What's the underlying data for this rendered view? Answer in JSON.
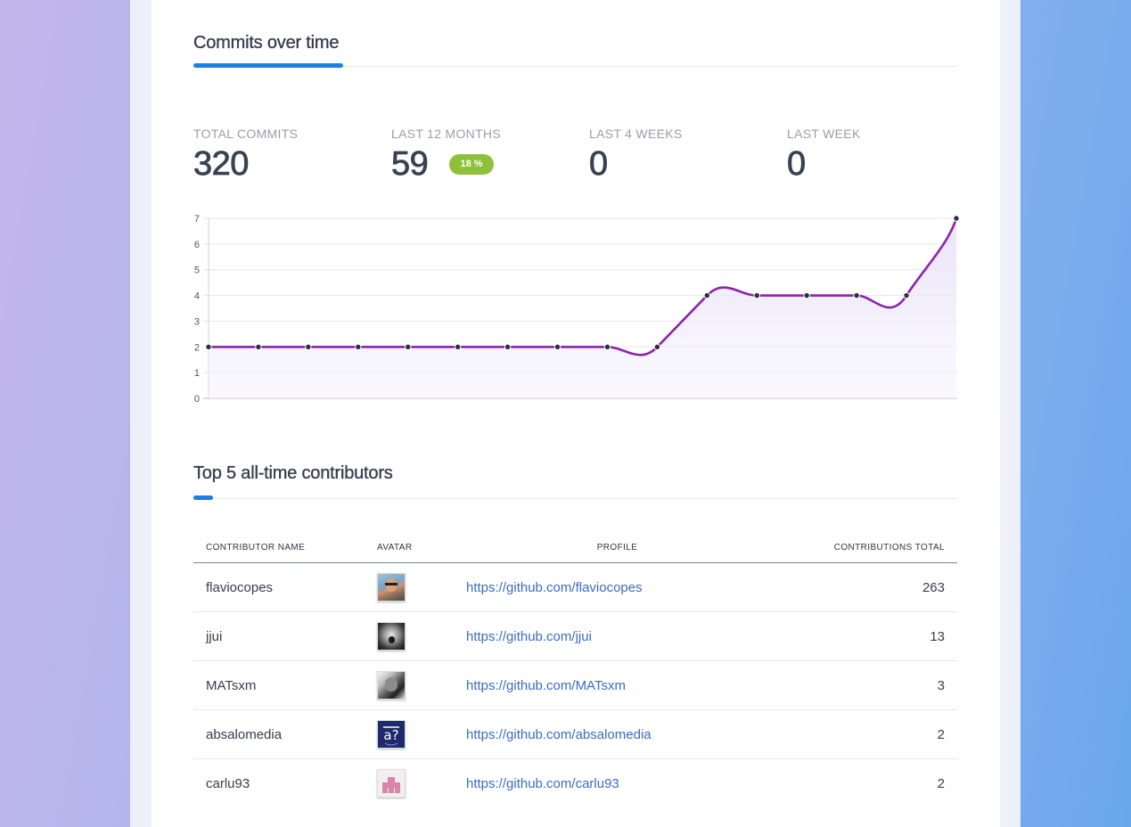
{
  "commits_section": {
    "title": "Commits over time",
    "stats": [
      {
        "label": "TOTAL COMMITS",
        "value": "320"
      },
      {
        "label": "LAST 12 MONTHS",
        "value": "59",
        "badge": "18 %"
      },
      {
        "label": "LAST 4 WEEKS",
        "value": "0"
      },
      {
        "label": "LAST WEEK",
        "value": "0"
      }
    ]
  },
  "chart_data": {
    "type": "area",
    "x": [
      1,
      2,
      3,
      4,
      5,
      6,
      7,
      8,
      9,
      10,
      11,
      12,
      13,
      14,
      15,
      16
    ],
    "series": [
      {
        "values": [
          2,
          2,
          2,
          2,
          2,
          2,
          2,
          2,
          2,
          2,
          4,
          4,
          4,
          4,
          4,
          7
        ]
      }
    ],
    "y_ticks": [
      "0",
      "1",
      "2",
      "3",
      "4",
      "5",
      "6",
      "7"
    ],
    "ylim": [
      0,
      7
    ],
    "grid": true,
    "colors": {
      "line": "#8e24aa",
      "fill": "#ede8fa",
      "point": "#2b2f3a",
      "grid": "#e5e6ea"
    }
  },
  "contributors_section": {
    "title": "Top 5 all-time contributors",
    "columns": {
      "name": "CONTRIBUTOR NAME",
      "avatar": "AVATAR",
      "profile": "PROFILE",
      "total": "CONTRIBUTIONS TOTAL"
    },
    "rows": [
      {
        "name": "flaviocopes",
        "profile": "https://github.com/flaviocopes",
        "total": "263",
        "avatar_icon": "photo-avatar-icon"
      },
      {
        "name": "jjui",
        "profile": "https://github.com/jjui",
        "total": "13",
        "avatar_icon": "photo-avatar-icon"
      },
      {
        "name": "MATsxm",
        "profile": "https://github.com/MATsxm",
        "total": "3",
        "avatar_icon": "photo-avatar-icon"
      },
      {
        "name": "absalomedia",
        "profile": "https://github.com/absalomedia",
        "total": "2",
        "avatar_icon": "logo-avatar-icon"
      },
      {
        "name": "carlu93",
        "profile": "https://github.com/carlu93",
        "total": "2",
        "avatar_icon": "identicon-avatar-icon"
      }
    ]
  },
  "colors": {
    "accent": "#1a7fe6",
    "badge": "#8fc03a",
    "link": "#3a6cc4"
  }
}
